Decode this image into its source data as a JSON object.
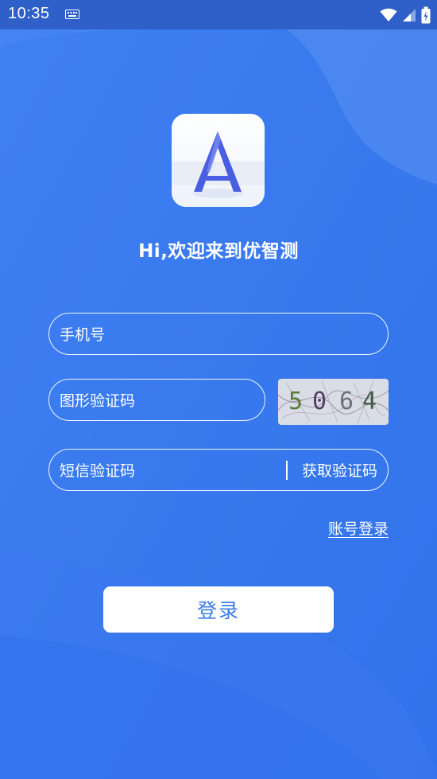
{
  "status_bar": {
    "time": "10:35"
  },
  "welcome_text": "Hi,欢迎来到优智测",
  "logo_letter": "A",
  "form": {
    "phone_placeholder": "手机号",
    "captcha_placeholder": "图形验证码",
    "captcha_digits": [
      "5",
      "0",
      "6",
      "4"
    ],
    "sms_placeholder": "短信验证码",
    "sms_get_label": "获取验证码"
  },
  "account_login_label": "账号登录",
  "login_button_label": "登录",
  "colors": {
    "background": "#3c7cf0",
    "status_bar": "#2f5fc8",
    "button_text": "#3b7be8"
  }
}
